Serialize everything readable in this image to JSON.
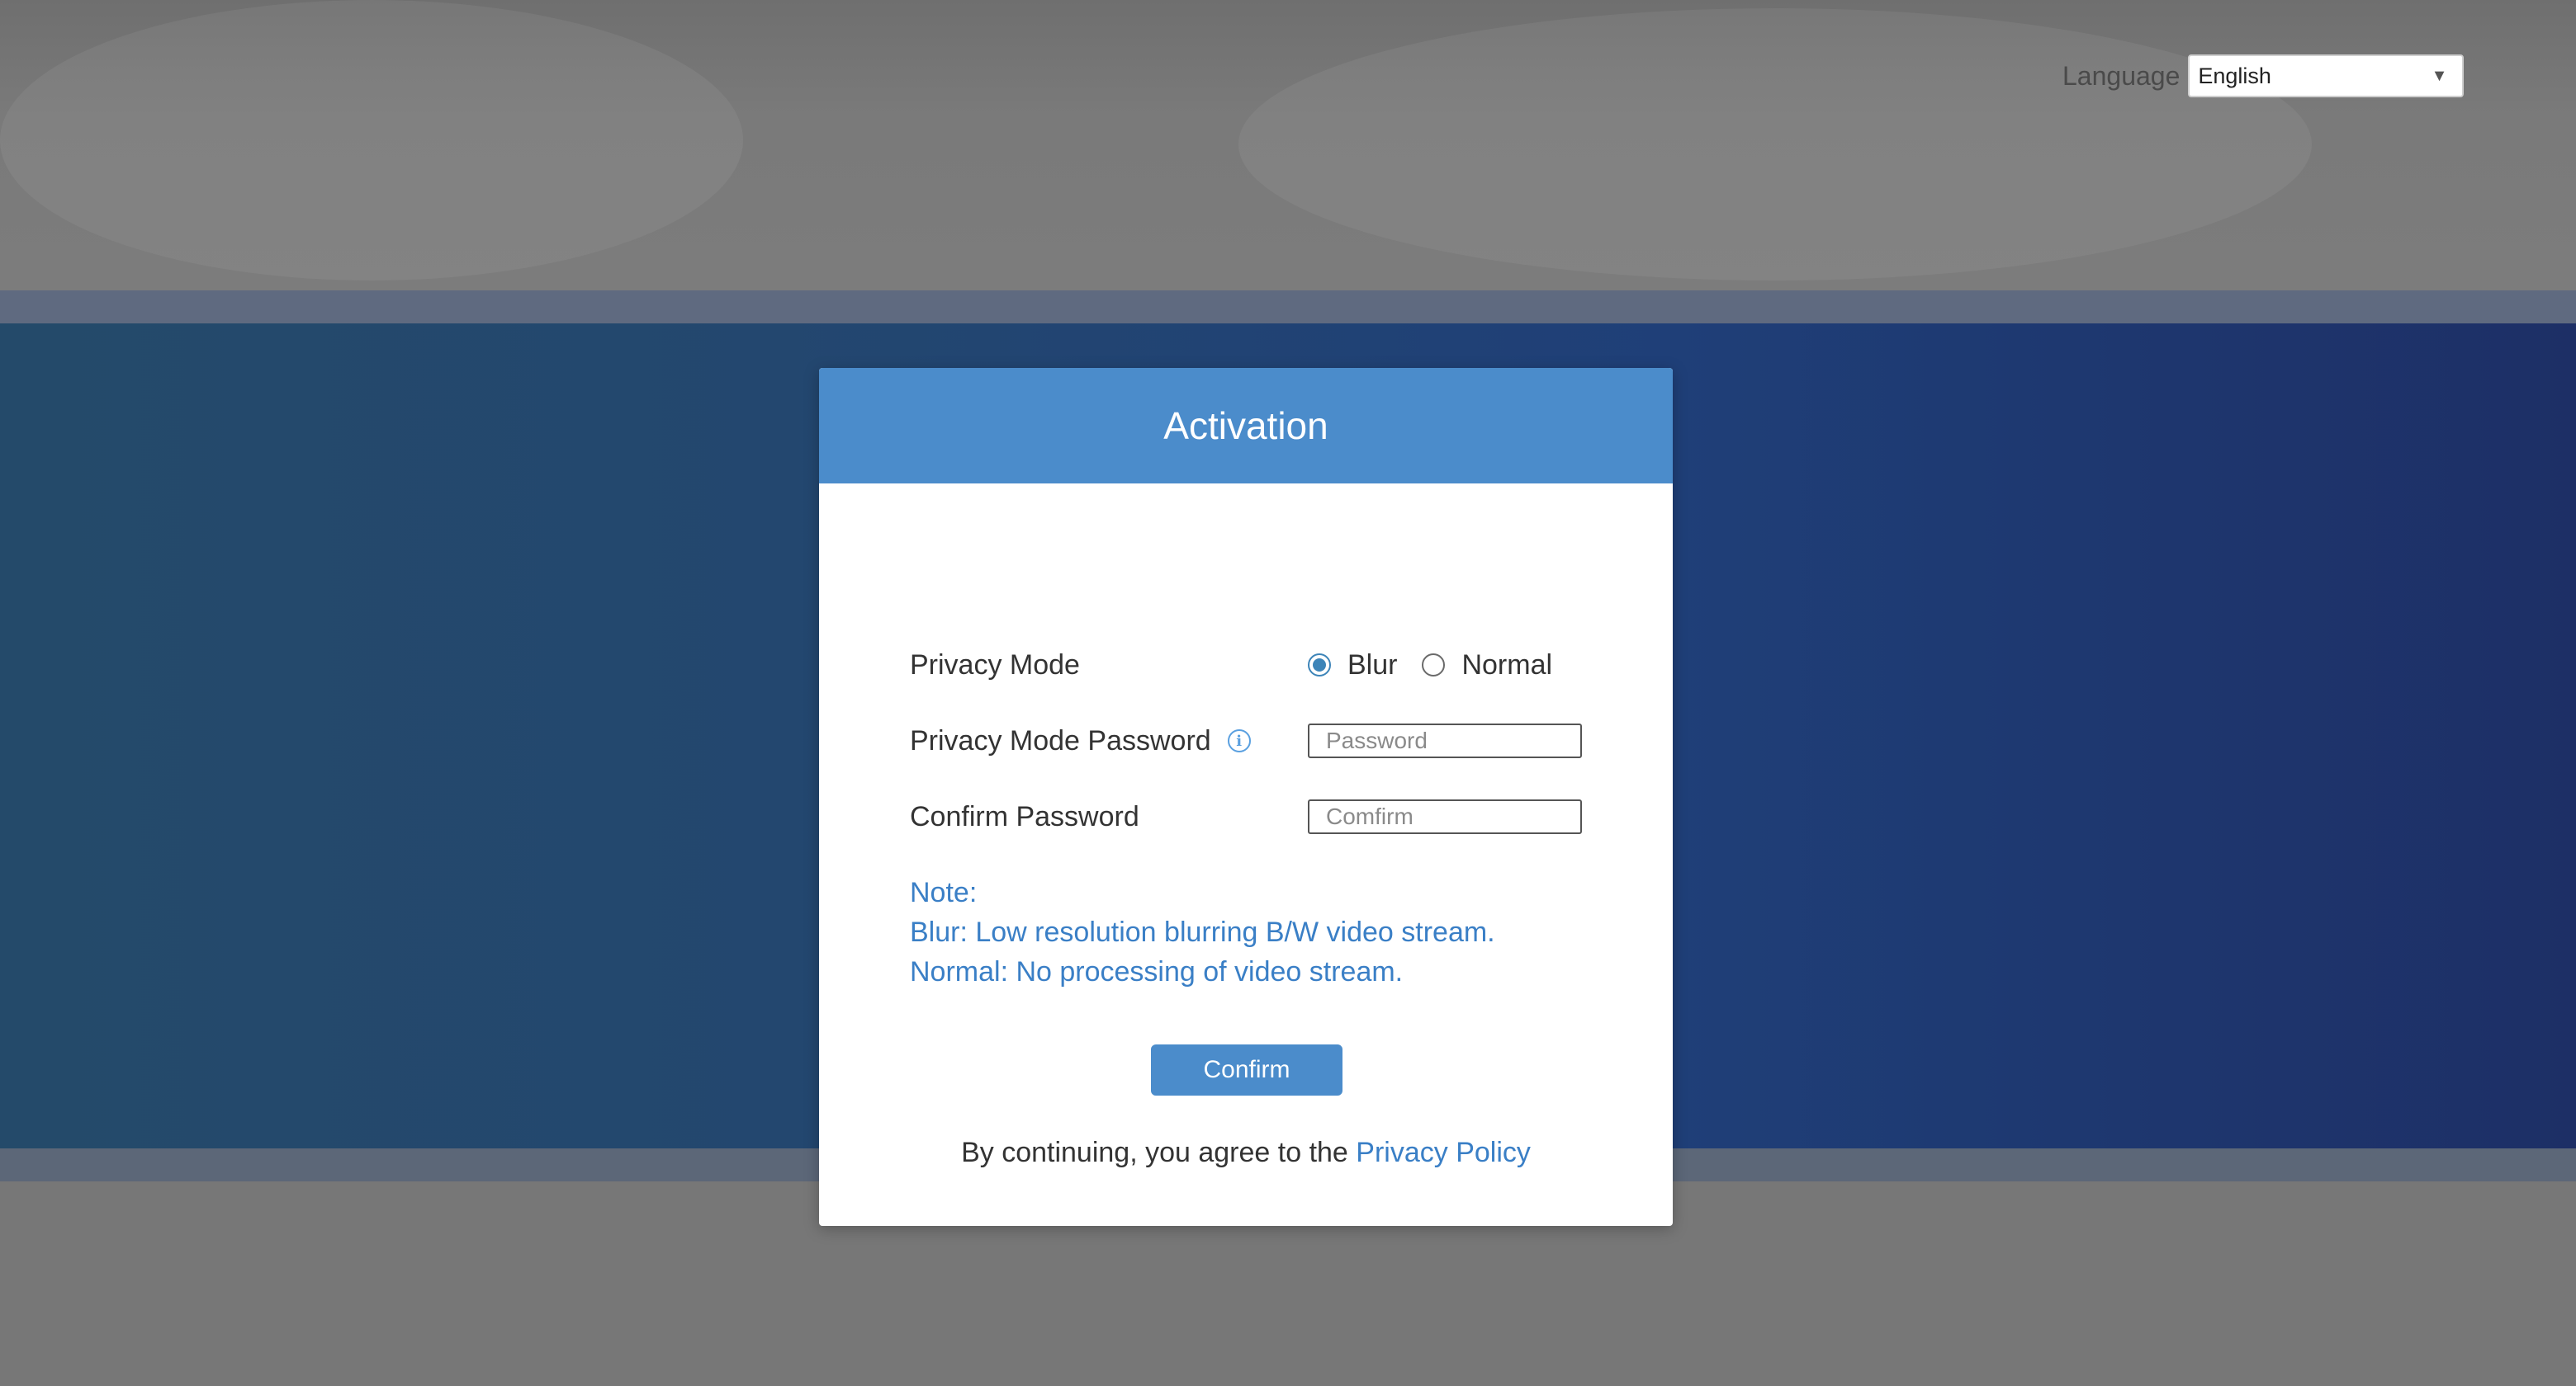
{
  "language": {
    "label": "Language",
    "selected": "English"
  },
  "dialog": {
    "title": "Activation",
    "privacy_mode": {
      "label": "Privacy Mode",
      "options": [
        {
          "label": "Blur",
          "checked": true
        },
        {
          "label": "Normal",
          "checked": false
        }
      ]
    },
    "privacy_password": {
      "label": "Privacy Mode Password",
      "placeholder": "Password"
    },
    "confirm_password": {
      "label": "Confirm Password",
      "placeholder": "Comfirm"
    },
    "note": {
      "heading": "Note:",
      "lines": [
        "Blur: Low resolution blurring B/W video stream.",
        "Normal: No processing of video stream."
      ]
    },
    "confirm_label": "Confirm",
    "agree_text": "By continuing, you agree to the ",
    "privacy_policy_link": "Privacy Policy"
  },
  "colors": {
    "accent": "#4b8ccb",
    "link": "#3a7fc6",
    "band": "#23476f"
  }
}
